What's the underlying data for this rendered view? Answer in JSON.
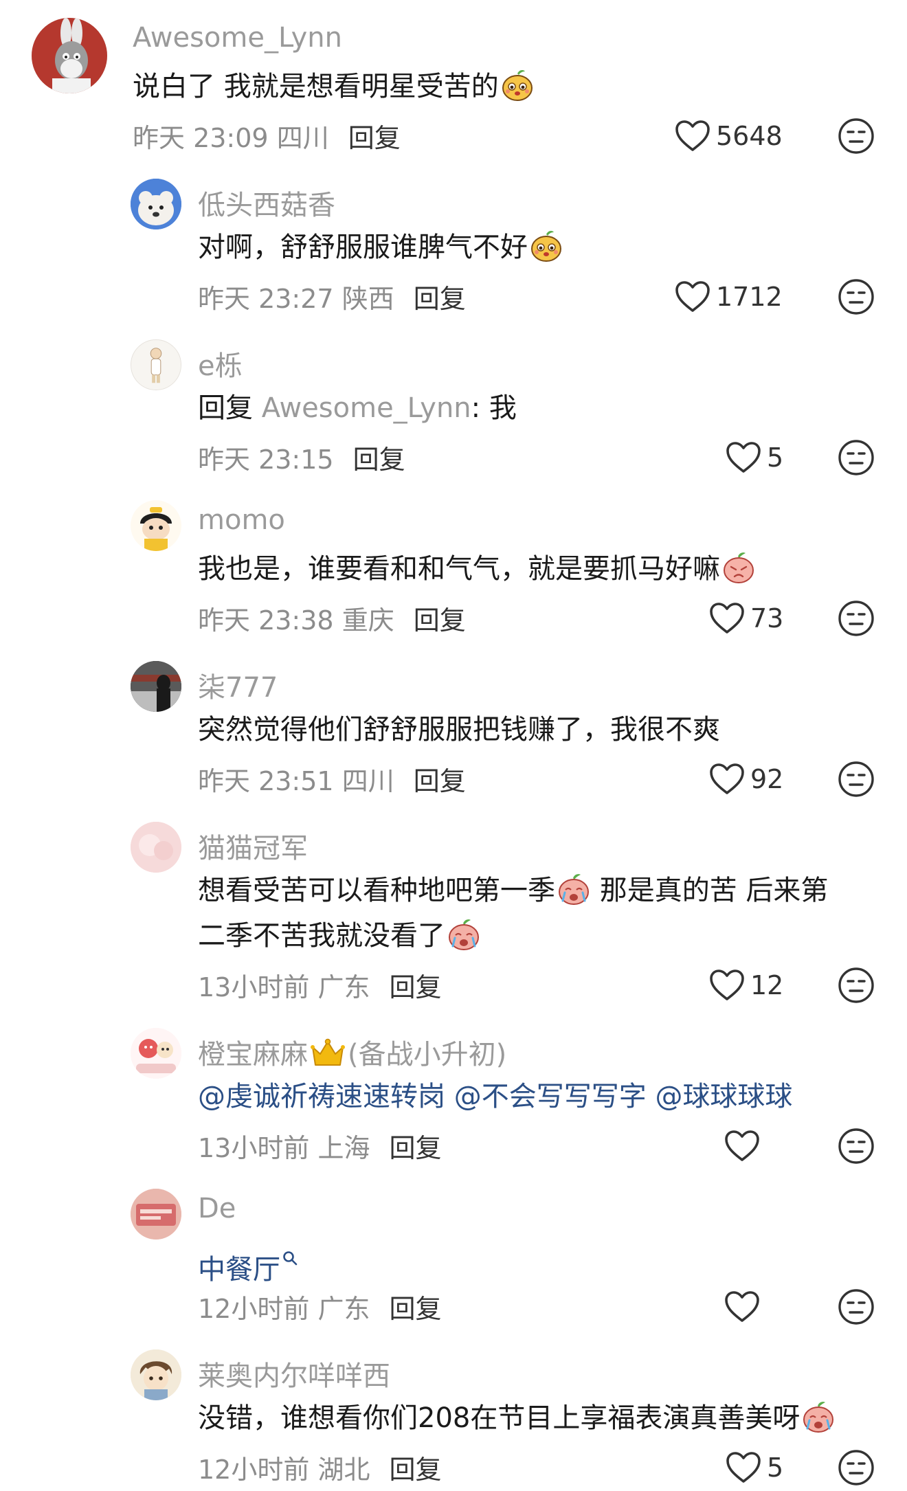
{
  "comments": [
    {
      "username": "Awesome_Lynn",
      "text": "说白了 我就是想看明星受苦的",
      "time": "昨天 23:09",
      "location": "四川",
      "reply_label": "回复",
      "likes": "5648",
      "avatar_icon": "rabbit-cartoon",
      "emoji": "mango-face"
    },
    {
      "username": "低头西菇香",
      "text": "对啊，舒舒服服谁脾气不好",
      "time": "昨天 23:27",
      "location": "陕西",
      "reply_label": "回复",
      "likes": "1712",
      "avatar_icon": "bear-plush",
      "emoji": "mango-face"
    },
    {
      "username": "e栎",
      "reply_prefix": "回复",
      "reply_to": "Awesome_Lynn",
      "text": ": 我",
      "time": "昨天 23:15",
      "location": "",
      "reply_label": "回复",
      "likes": "5",
      "avatar_icon": "doll-figure"
    },
    {
      "username": "momo",
      "text": "我也是，谁要看和和气气，就是要抓马好嘛",
      "time": "昨天 23:38",
      "location": "重庆",
      "reply_label": "回复",
      "likes": "73",
      "avatar_icon": "cartoon-boy",
      "emoji": "peach-hurt"
    },
    {
      "username": "柒777",
      "text": "突然觉得他们舒舒服服把钱赚了，我很不爽",
      "time": "昨天 23:51",
      "location": "四川",
      "reply_label": "回复",
      "likes": "92",
      "avatar_icon": "street-photo"
    },
    {
      "username": "猫猫冠军",
      "text_line1": "想看受苦可以看种地吧第一季",
      "text_line1b": " 那是真的苦 后来第",
      "text_line2": "二季不苦我就没看了",
      "time": "13小时前",
      "location": "广东",
      "reply_label": "回复",
      "likes": "12",
      "avatar_icon": "pink-blur",
      "emoji": "peach-cry"
    },
    {
      "username": "橙宝麻麻",
      "username_suffix": "(备战小升初)",
      "mentions": [
        "@虔诚祈祷速速转岗",
        "@不会写写写字",
        "@球球球球"
      ],
      "time": "13小时前",
      "location": "上海",
      "reply_label": "回复",
      "likes": "",
      "avatar_icon": "cartoon-group",
      "badge_icon": "crown"
    },
    {
      "username": "De",
      "text": "中餐厅",
      "time": "12小时前",
      "location": "广东",
      "reply_label": "回复",
      "likes": "",
      "avatar_icon": "pink-card",
      "trailing_icon": "search-icon"
    },
    {
      "username": "莱奥内尔咩咩西",
      "text": "没错，谁想看你们208在节目上享福表演真善美呀",
      "time": "12小时前",
      "location": "湖北",
      "reply_label": "回复",
      "likes": "5",
      "avatar_icon": "anime-boy",
      "emoji": "peach-sick"
    }
  ],
  "colors": {
    "username": "#9a9a9a",
    "text": "#1a1a1a",
    "meta": "#8c8c8c",
    "mention": "#2b4f86"
  }
}
